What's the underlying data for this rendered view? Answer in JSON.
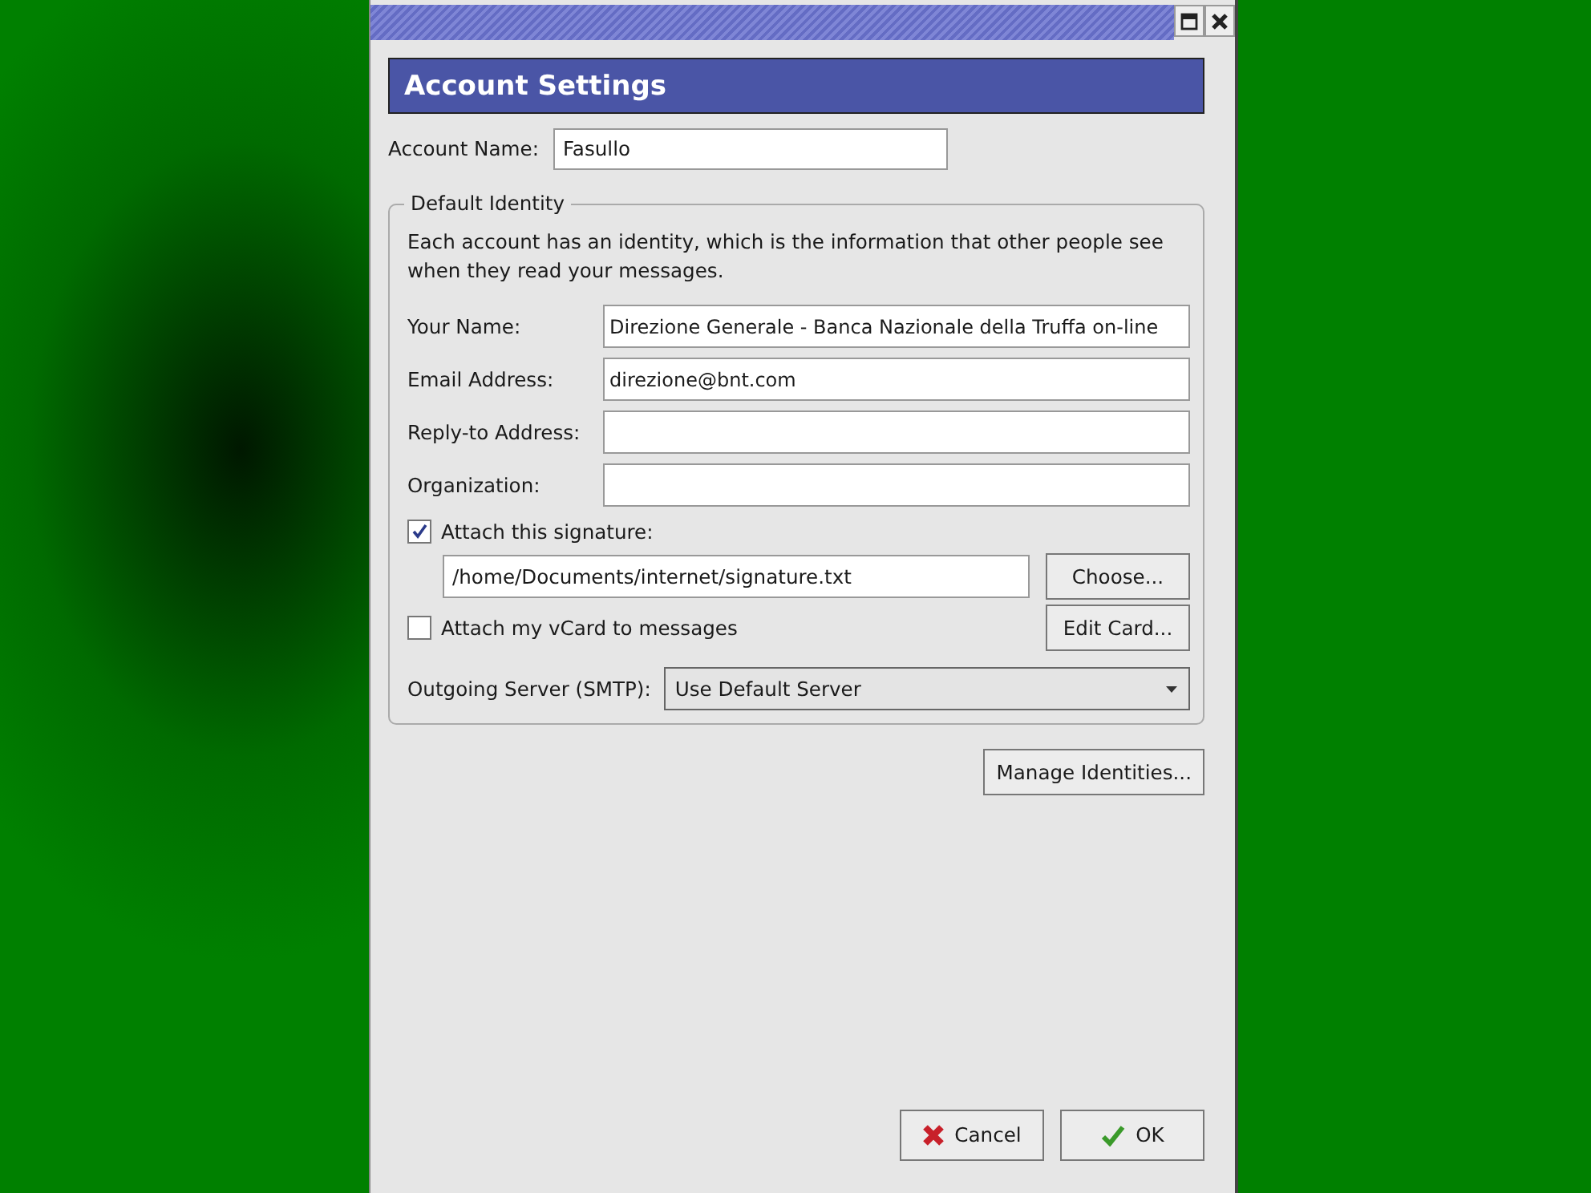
{
  "window": {
    "buttons": [
      {
        "kind": "maximize"
      },
      {
        "kind": "close"
      }
    ]
  },
  "header": {
    "title": "Account Settings"
  },
  "account_name": {
    "label": "Account Name:",
    "value": "Fasullo"
  },
  "identity": {
    "legend": "Default Identity",
    "description": "Each account has an identity, which is the information that other people see when they read your messages.",
    "fields": [
      {
        "label": "Your Name:",
        "value": "Direzione Generale - Banca Nazionale della Truffa on-line"
      },
      {
        "label": "Email Address:",
        "value": "direzione@bnt.com"
      },
      {
        "label": "Reply-to Address:"
      },
      {
        "label": "Organization:"
      }
    ],
    "signature": {
      "label": "Attach this signature:",
      "checked": true,
      "path": "/home/Documents/internet/signature.txt",
      "button": "Choose..."
    },
    "vcard": {
      "label": "Attach my vCard to messages",
      "checked": false,
      "button": "Edit Card..."
    },
    "smtp": {
      "label": "Outgoing Server (SMTP):",
      "value": "Use Default Server"
    }
  },
  "manage_button": "Manage Identities...",
  "buttons": [
    {
      "kind": "cancel",
      "label": "Cancel"
    },
    {
      "kind": "ok",
      "label": "OK"
    }
  ]
}
